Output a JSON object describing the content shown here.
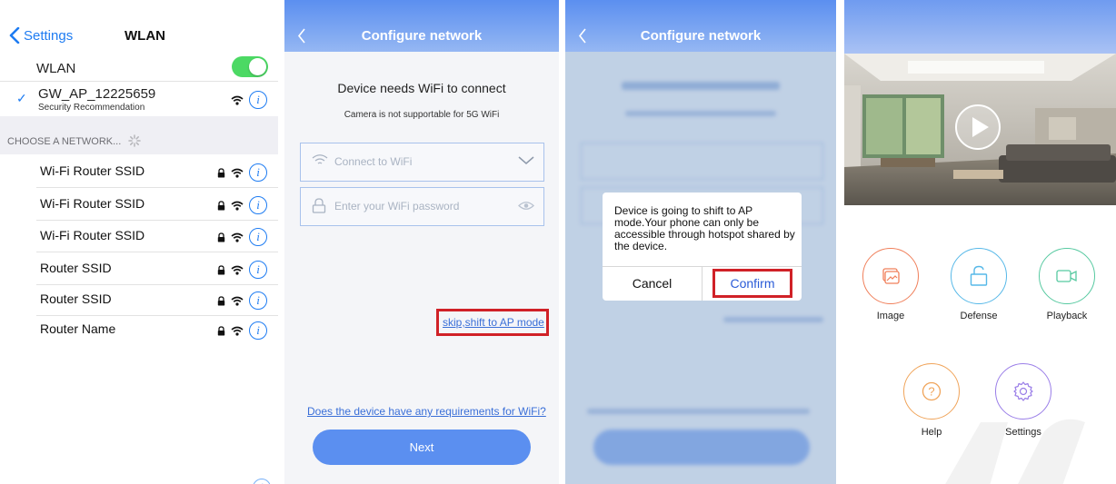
{
  "wlan_screen": {
    "back_label": "Settings",
    "title": "WLAN",
    "wlan_label": "WLAN",
    "connected_ssid": "GW_AP_12225659",
    "connected_sub": "Security Recommendation",
    "section_label": "CHOOSE A NETWORK...",
    "networks": [
      {
        "name": "Wi-Fi Router SSID"
      },
      {
        "name": "Wi-Fi Router SSID"
      },
      {
        "name": "Wi-Fi Router SSID"
      },
      {
        "name": "Router SSID"
      },
      {
        "name": "Router SSID"
      },
      {
        "name": "Router Name"
      }
    ],
    "toggle_on": true,
    "accent": "#1e7cf2",
    "toggle_color": "#4cd964"
  },
  "configure_screen": {
    "title": "Configure network",
    "heading": "Device needs WiFi to connect",
    "subheading": "Camera is not supportable for 5G WiFi",
    "wifi_placeholder": "Connect to WiFi",
    "password_placeholder": "Enter your WiFi password",
    "skip_link": "skip,shift to AP mode",
    "requirements_link": "Does the device have any requirements for WiFi?",
    "next_label": "Next",
    "header_color": "#5b8ff0"
  },
  "dialog_screen": {
    "title": "Configure network",
    "message": "Device is going to shift to AP mode.Your phone can only be accessible through hotspot shared by the device.",
    "cancel_label": "Cancel",
    "confirm_label": "Confirm",
    "highlight_color": "#d02127"
  },
  "device_screen": {
    "tiles": [
      {
        "label": "Image",
        "icon": "image-icon",
        "color": "#f07f5a"
      },
      {
        "label": "Defense",
        "icon": "lock-icon",
        "color": "#56b8e8"
      },
      {
        "label": "Playback",
        "icon": "video-camera-icon",
        "color": "#56c9a0"
      },
      {
        "label": "Help",
        "icon": "help-icon",
        "color": "#f0a45a"
      },
      {
        "label": "Settings",
        "icon": "gear-icon",
        "color": "#9a7ee8"
      }
    ]
  }
}
